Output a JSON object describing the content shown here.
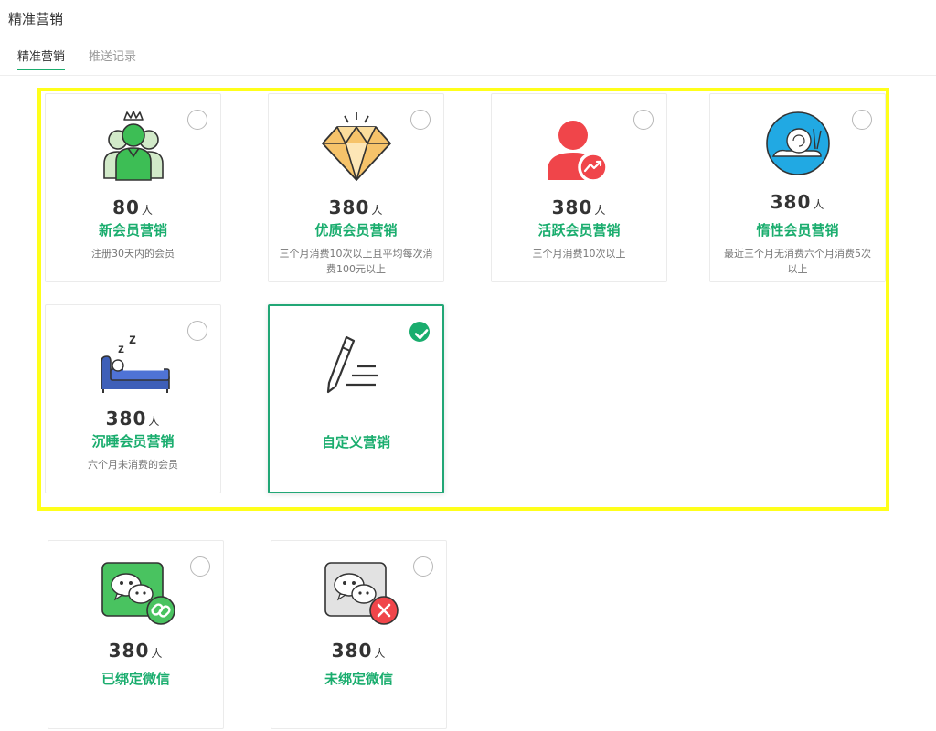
{
  "page": {
    "title": "精准营销"
  },
  "tabs": [
    {
      "label": "精准营销",
      "active": true
    },
    {
      "label": "推送记录",
      "active": false
    }
  ],
  "colors": {
    "accent": "#1aad6e",
    "highlight": "#ffff1a"
  },
  "cards": [
    {
      "icon": "crowned-member-icon",
      "count": "80",
      "unit": "人",
      "name": "新会员营销",
      "desc": "注册30天内的会员",
      "selected": false
    },
    {
      "icon": "diamond-icon",
      "count": "380",
      "unit": "人",
      "name": "优质会员营销",
      "desc": "三个月消费10次以上且平均每次消费100元以上",
      "selected": false
    },
    {
      "icon": "active-user-trend-icon",
      "count": "380",
      "unit": "人",
      "name": "活跃会员营销",
      "desc": "三个月消费10次以上",
      "selected": false
    },
    {
      "icon": "snail-icon",
      "count": "380",
      "unit": "人",
      "name": "惰性会员营销",
      "desc": "最近三个月无消费六个月消费5次以上",
      "selected": false
    },
    {
      "icon": "sleeping-bed-icon",
      "count": "380",
      "unit": "人",
      "name": "沉睡会员营销",
      "desc": "六个月未消费的会员",
      "selected": false
    },
    {
      "icon": "pencil-edit-icon",
      "count": "",
      "unit": "",
      "name": "自定义营销",
      "desc": "",
      "selected": true
    },
    {
      "icon": "wechat-bound-icon",
      "count": "380",
      "unit": "人",
      "name": "已绑定微信",
      "desc": "",
      "selected": false
    },
    {
      "icon": "wechat-unbound-icon",
      "count": "380",
      "unit": "人",
      "name": "未绑定微信",
      "desc": "",
      "selected": false
    }
  ]
}
